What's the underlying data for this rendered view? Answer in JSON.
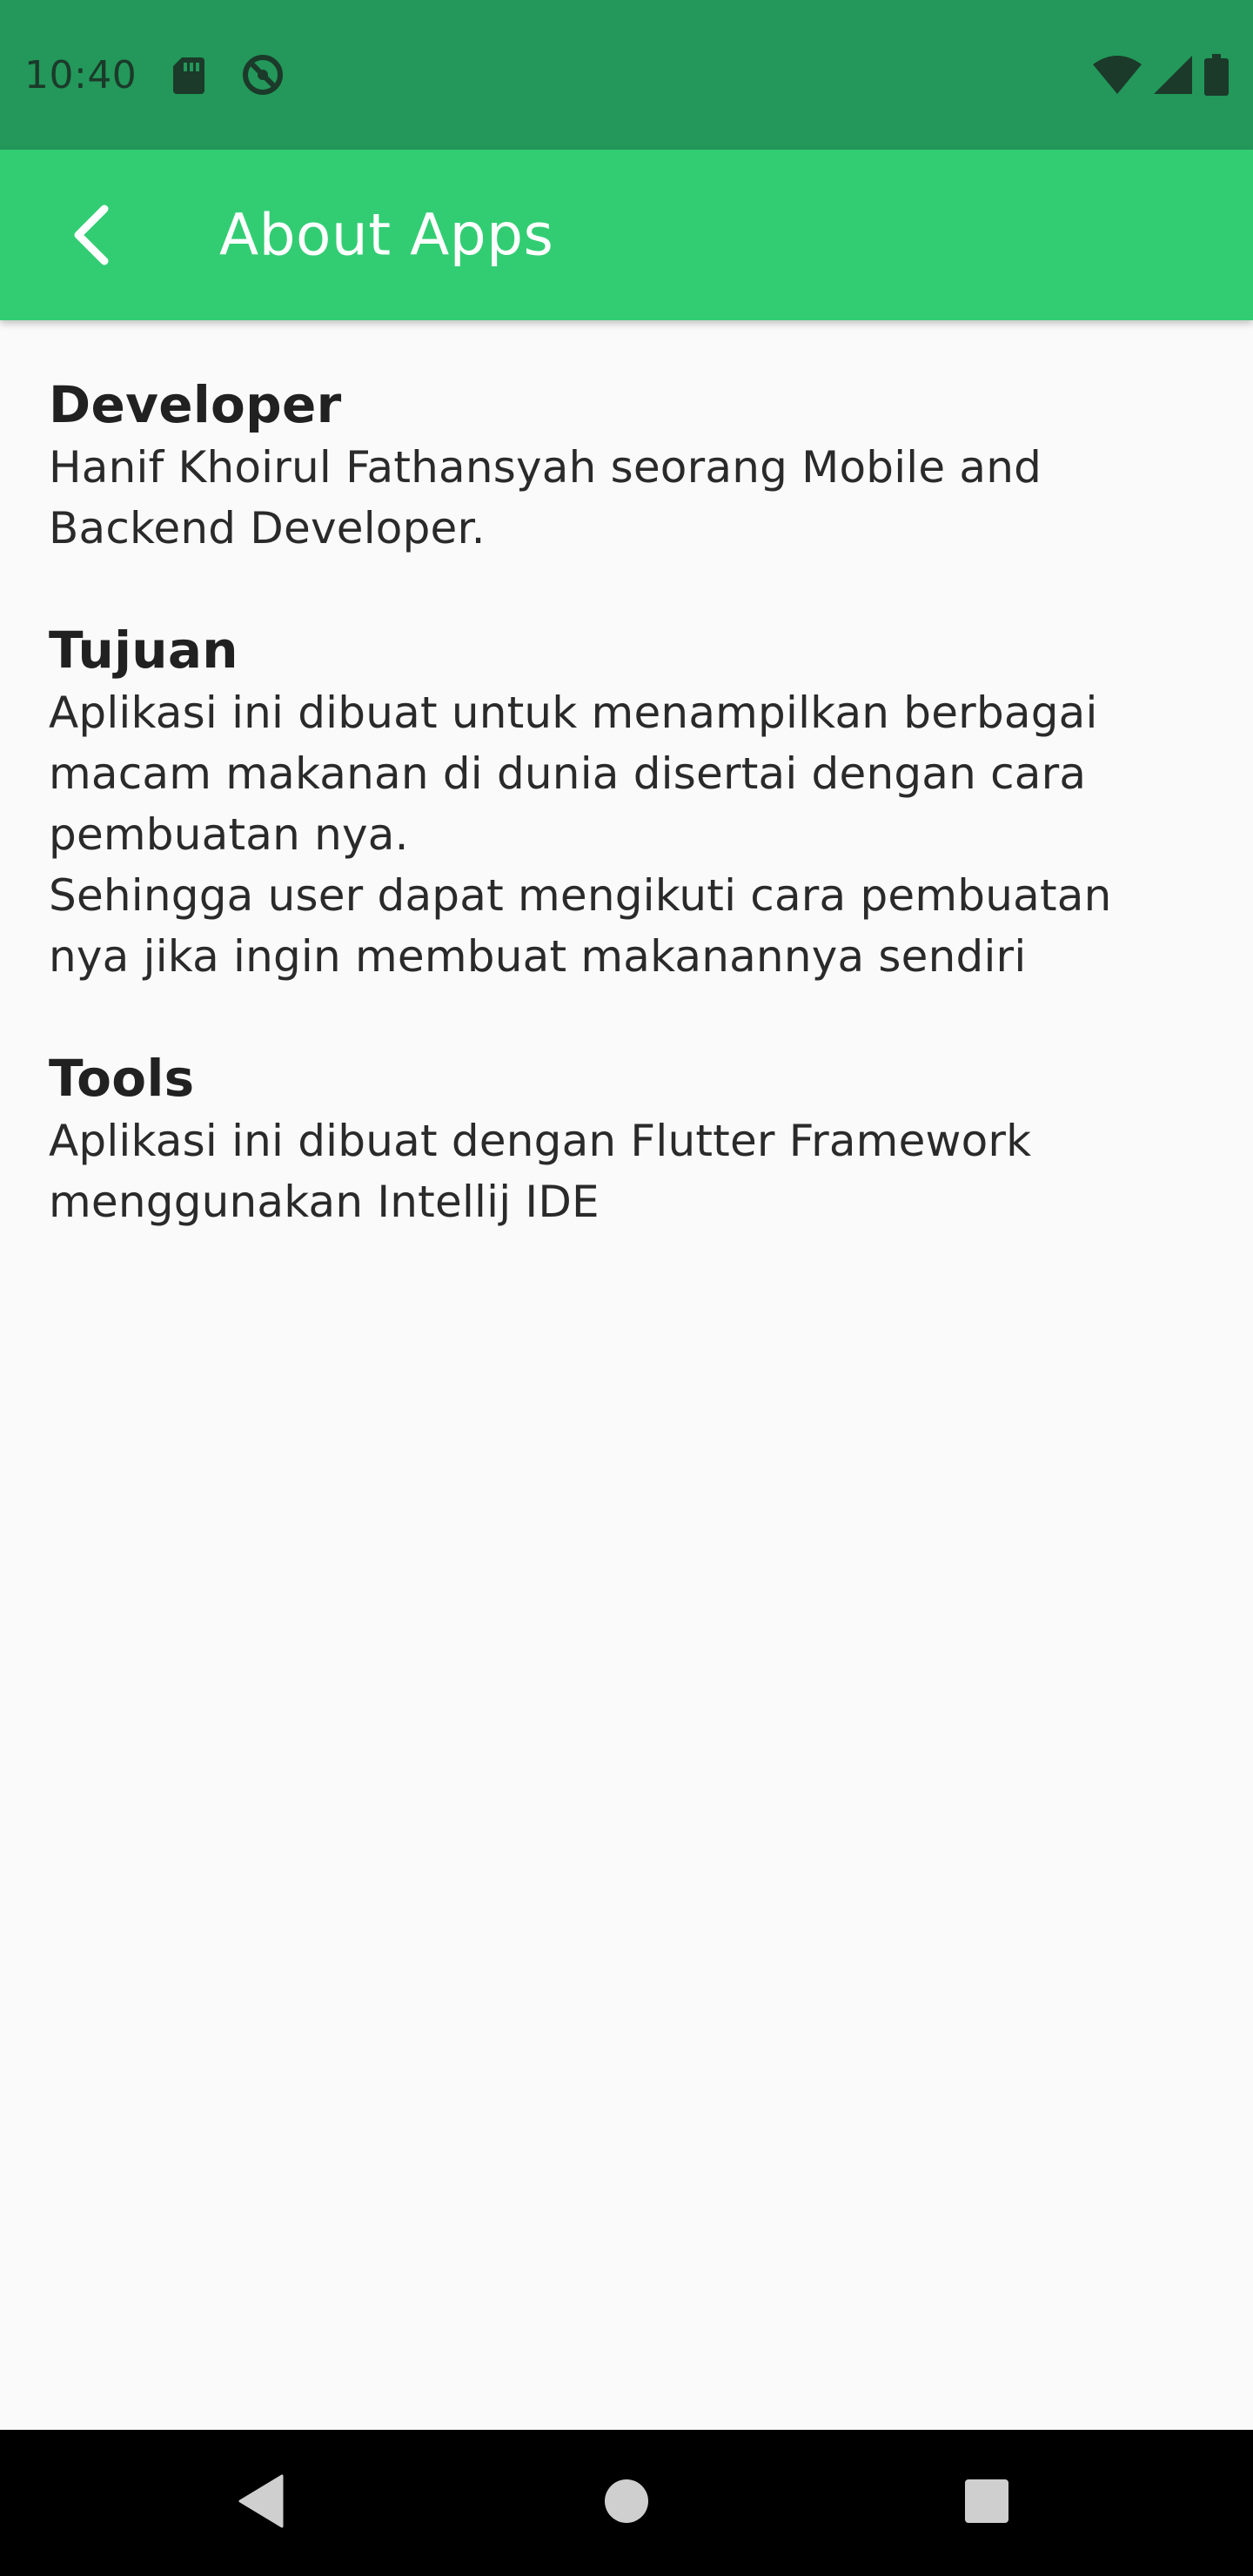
{
  "status_bar": {
    "time": "10:40",
    "left_icons": [
      "sd-card-icon",
      "do-not-disturb-icon"
    ],
    "right_icons": [
      "wifi-icon",
      "cellular-signal-icon",
      "battery-icon"
    ],
    "background_color": "#23985a"
  },
  "app_bar": {
    "title": "About Apps",
    "back_icon": "chevron-left-icon",
    "background_color": "#32cd73"
  },
  "sections": [
    {
      "heading": "Developer",
      "lines": [
        "Hanif Khoirul Fathansyah seorang Mobile and Backend Developer."
      ]
    },
    {
      "heading": "Tujuan",
      "lines": [
        "Aplikasi ini dibuat untuk menampilkan berbagai macam makanan di dunia disertai dengan cara pembuatan nya.",
        "Sehingga user dapat mengikuti cara pembuatan nya jika ingin membuat makanannya sendiri"
      ]
    },
    {
      "heading": "Tools",
      "lines": [
        "Aplikasi ini dibuat dengan Flutter Framework menggunakan Intellij IDE"
      ]
    }
  ],
  "nav_bar": {
    "buttons": [
      "back-triangle-icon",
      "home-circle-icon",
      "recents-square-icon"
    ]
  }
}
